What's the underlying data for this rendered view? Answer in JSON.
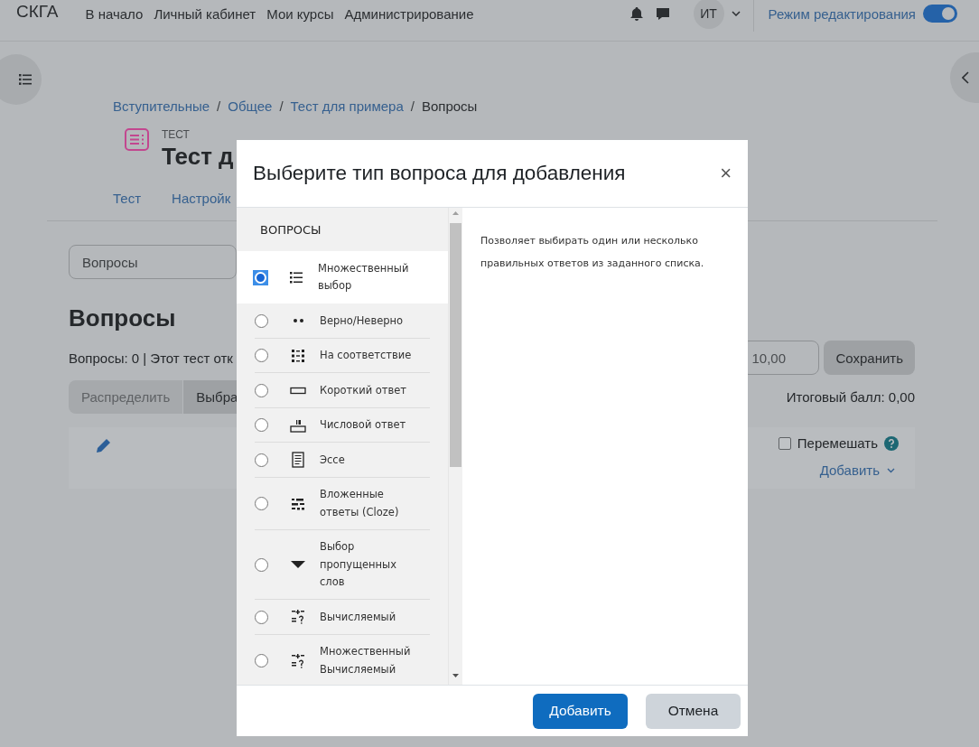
{
  "navbar": {
    "brand": "СКГА",
    "links": [
      "В начало",
      "Личный кабинет",
      "Мои курсы",
      "Администрирование"
    ],
    "user_initials": "ИТ",
    "edit_mode": {
      "label": "Режим редактирования",
      "on": true
    }
  },
  "breadcrumb": [
    {
      "label": "Вступительные",
      "kind": "link"
    },
    {
      "label": "/",
      "kind": "separator"
    },
    {
      "label": "Общее",
      "kind": "link"
    },
    {
      "label": "/",
      "kind": "separator"
    },
    {
      "label": "Тест для примера",
      "kind": "link"
    },
    {
      "label": "/",
      "kind": "separator"
    },
    {
      "label": "Вопросы",
      "kind": "current"
    }
  ],
  "header": {
    "kicker": "ТЕСТ",
    "title": "Тест д"
  },
  "tabs": [
    {
      "label": "Тест",
      "selected": false
    },
    {
      "label": "Настройк",
      "selected": false
    }
  ],
  "page_select": {
    "value": "Вопросы"
  },
  "heading": "Вопросы",
  "summary": "Вопросы: 0 | Этот тест отк",
  "max_grade": {
    "value": "10,00"
  },
  "save_button": "Сохранить",
  "action_buttons": [
    {
      "label": "Распределить",
      "disabled": true
    },
    {
      "label": "Выбра",
      "disabled": false
    }
  ],
  "total_grade": "Итоговый балл: 0,00",
  "shuffle": {
    "label": "Перемешать",
    "checked": false
  },
  "add_menu": "Добавить",
  "modal": {
    "title": "Выберите тип вопроса для добавления",
    "close": "×",
    "section": "ВОПРОСЫ",
    "types": [
      {
        "label": "Множественный выбор",
        "kind": "list",
        "selected": true
      },
      {
        "label": "Верно/Неверно",
        "kind": "dots",
        "selected": false
      },
      {
        "label": "На соответствие",
        "kind": "grid",
        "selected": false
      },
      {
        "label": "Короткий ответ",
        "kind": "line",
        "selected": false
      },
      {
        "label": "Числовой ответ",
        "kind": "numeric",
        "selected": false
      },
      {
        "label": "Эссе",
        "kind": "essay",
        "selected": false
      },
      {
        "label": "Вложенные ответы (Cloze)",
        "kind": "cloze",
        "selected": false
      },
      {
        "label": "Выбор пропущенных слов",
        "kind": "dropdown",
        "selected": false
      },
      {
        "label": "Вычисляемый",
        "kind": "calc",
        "selected": false
      },
      {
        "label": "Множественный Вычисляемый",
        "kind": "calc",
        "selected": false
      }
    ],
    "description": "Позволяет выбирать один или несколько правильных ответов из заданного списка.",
    "buttons": [
      {
        "label": "Добавить",
        "kind": "primary"
      },
      {
        "label": "Отмена",
        "kind": "secondary"
      }
    ]
  }
}
